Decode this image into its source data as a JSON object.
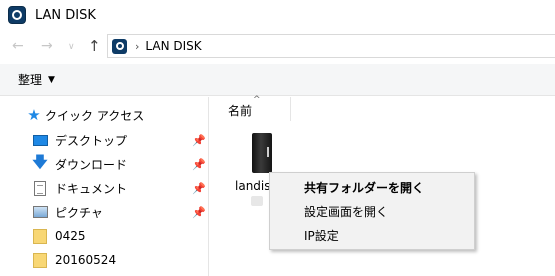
{
  "window": {
    "title": "LAN DISK",
    "app_icon": "landisk-app-icon"
  },
  "address_bar": {
    "separator": "›",
    "path": "LAN DISK"
  },
  "toolbar": {
    "organize_label": "整理",
    "organize_arrow": "▼"
  },
  "navigation": {
    "quick_access": "クイック アクセス",
    "items": [
      {
        "label": "デスクトップ",
        "icon": "desktop-icon",
        "pinned": true
      },
      {
        "label": "ダウンロード",
        "icon": "download-icon",
        "pinned": true
      },
      {
        "label": "ドキュメント",
        "icon": "documents-icon",
        "pinned": true
      },
      {
        "label": "ピクチャ",
        "icon": "pictures-icon",
        "pinned": true
      },
      {
        "label": "0425",
        "icon": "folder-icon",
        "pinned": false
      },
      {
        "label": "20160524",
        "icon": "folder-icon",
        "pinned": false
      }
    ]
  },
  "content": {
    "column_name": "名前",
    "file": {
      "label": "landisk",
      "icon": "nas-device-icon"
    }
  },
  "context_menu": [
    {
      "label": "共有フォルダーを開く",
      "bold": true
    },
    {
      "label": "設定画面を開く",
      "bold": false
    },
    {
      "label": "IP設定",
      "bold": false
    }
  ],
  "colors": {
    "accent": "#1e88e5",
    "app_icon": "#0e3b66",
    "folder": "#f8d775"
  }
}
